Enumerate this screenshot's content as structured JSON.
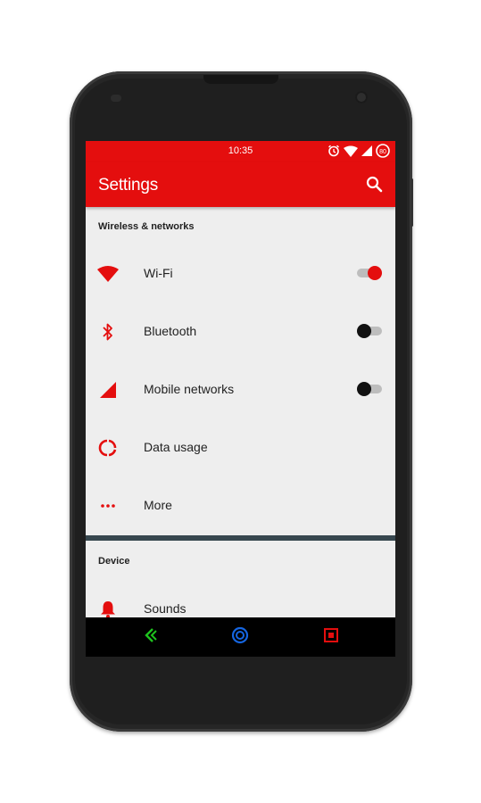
{
  "status_bar": {
    "time": "10:35",
    "icons": [
      "alarm-icon",
      "wifi-icon",
      "cellular-icon",
      "battery-icon"
    ],
    "battery_level": "80"
  },
  "app_bar": {
    "title": "Settings",
    "search_icon": "search-icon"
  },
  "sections": {
    "wireless": {
      "header": "Wireless & networks",
      "items": [
        {
          "label": "Wi-Fi",
          "icon": "wifi-icon",
          "toggle": true
        },
        {
          "label": "Bluetooth",
          "icon": "bluetooth-icon",
          "toggle": false
        },
        {
          "label": "Mobile networks",
          "icon": "mobile-signal-icon",
          "toggle": false
        },
        {
          "label": "Data usage",
          "icon": "data-usage-icon"
        },
        {
          "label": "More",
          "icon": "more-dots-icon"
        }
      ]
    },
    "device": {
      "header": "Device",
      "items": [
        {
          "label": "Sounds",
          "icon": "bell-icon"
        }
      ]
    }
  },
  "nav_bar": {
    "buttons": [
      "back-icon",
      "home-icon",
      "recents-icon"
    ]
  },
  "colors": {
    "accent": "#e40e0e",
    "background": "#eeeeee",
    "divider": "#37474f",
    "nav_back": "#1ec31e",
    "nav_home": "#1565e0",
    "nav_recents": "#e40e0e"
  }
}
